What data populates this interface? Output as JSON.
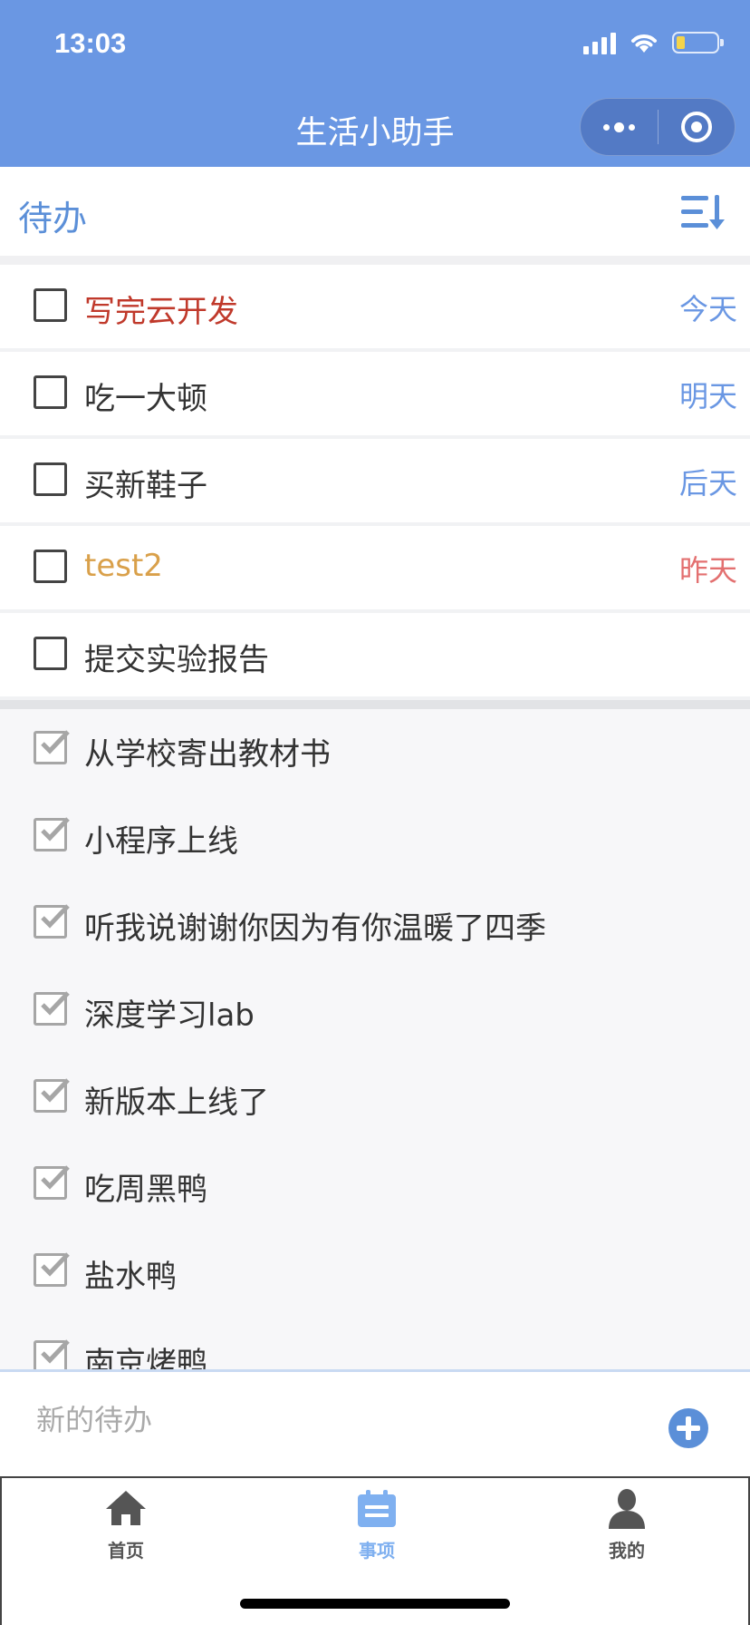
{
  "status_bar": {
    "time": "13:03"
  },
  "nav": {
    "title": "生活小助手"
  },
  "section": {
    "title": "待办"
  },
  "colors": {
    "accent": "#6a97e3",
    "overdue": "#e37070",
    "urgent": "#c0392b",
    "warning": "#d9a04a"
  },
  "todos": [
    {
      "text": "写完云开发",
      "date": "今天",
      "text_color": "#c0392b",
      "date_color": "#6a97e3"
    },
    {
      "text": "吃一大顿",
      "date": "明天",
      "text_color": "#333333",
      "date_color": "#6a97e3"
    },
    {
      "text": "买新鞋子",
      "date": "后天",
      "text_color": "#333333",
      "date_color": "#6a97e3"
    },
    {
      "text": "test2",
      "date": "昨天",
      "text_color": "#d9a04a",
      "date_color": "#e37070"
    },
    {
      "text": "提交实验报告",
      "date": "",
      "text_color": "#333333",
      "date_color": "#6a97e3"
    }
  ],
  "done": [
    "从学校寄出教材书",
    "小程序上线",
    "听我说谢谢你因为有你温暖了四季",
    "深度学习lab",
    "新版本上线了",
    "吃周黑鸭",
    "盐水鸭",
    "南京烤鸭"
  ],
  "new_todo": {
    "placeholder": "新的待办",
    "value": ""
  },
  "tabs": [
    {
      "label": "首页",
      "icon": "home-icon",
      "active": false
    },
    {
      "label": "事项",
      "icon": "calendar-icon",
      "active": true
    },
    {
      "label": "我的",
      "icon": "user-icon",
      "active": false
    }
  ]
}
